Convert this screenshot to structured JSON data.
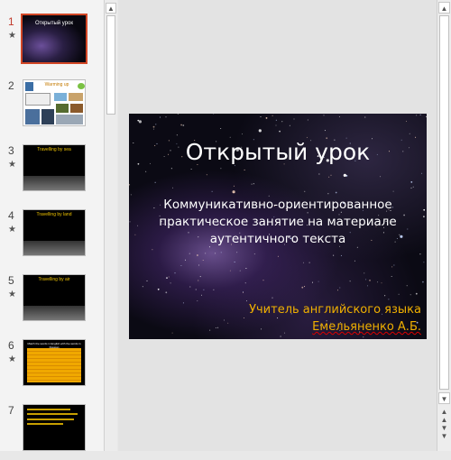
{
  "slides": [
    {
      "number": "1",
      "starred": true,
      "title": "Открытый урок"
    },
    {
      "number": "2",
      "starred": false,
      "title": "Warming up"
    },
    {
      "number": "3",
      "starred": true,
      "title": "Travelling by sea"
    },
    {
      "number": "4",
      "starred": true,
      "title": "Travelling by land"
    },
    {
      "number": "5",
      "starred": true,
      "title": "Travelling by air"
    },
    {
      "number": "6",
      "starred": true,
      "title": "Match the words in English with the words in Russian"
    },
    {
      "number": "7",
      "starred": false,
      "title": ""
    }
  ],
  "star_symbol": "★",
  "current_slide": {
    "title": "Открытый урок",
    "subtitle_lines": [
      "Коммуникативно-ориентированное",
      "практическое занятие на материале",
      "аутентичного текста"
    ],
    "author_line1": "Учитель английского языка",
    "author_line2": "Емельяненко А.Б."
  },
  "scroll": {
    "up": "▲",
    "down": "▼",
    "prev_slide": "⯭",
    "next_slide": "⯯"
  },
  "colors": {
    "selected_border": "#d24726",
    "author_text": "#f0b000",
    "thumb_title": "#f0c400"
  }
}
